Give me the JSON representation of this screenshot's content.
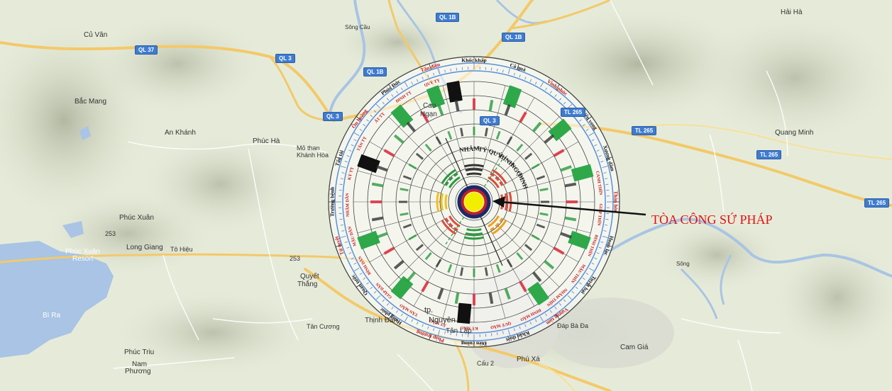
{
  "map": {
    "callout_text": "TÒA CÔNG SỨ PHÁP",
    "place_labels": [
      "Hải Hà",
      "Củ Vân",
      "Bắc Mang",
      "An Khánh",
      "Phúc Hà",
      "Mỏ than",
      "Khánh Hòa",
      "Phúc Xuân",
      "Phúc Xuân",
      "Resort",
      "Long Giang",
      "Quyết",
      "Thắng",
      "Bì Ra",
      "Phúc Triu",
      "Nam",
      "Phương",
      "Thịnh Đán",
      "Tân Cương",
      "Tân Lập",
      "Phú Xá",
      "Cam Giá",
      "Đáp Bà Đa",
      "Quang Minh",
      "Sông Cầu",
      "Cao",
      "Ngạn",
      "tp.",
      "Nguyên",
      "Sông"
    ],
    "road_labels": [
      "QL 37",
      "QL 3",
      "QL 1B",
      "QL 1B",
      "QL 3",
      "QL 1B",
      "QL 3",
      "TL 265",
      "TL 265",
      "TL 265",
      "TL 265",
      "253",
      "253",
      "Tô Hiệu",
      "Cấu 2"
    ],
    "compass": {
      "outer_ring_labels": [
        "Tấn điền",
        "Khốc khấp",
        "Cô quả",
        "Vinh phúc",
        "Thiếu vong",
        "Xương dâm",
        "Thân hôn",
        "Hoan lạc",
        "Tuyệt bại",
        "Vượng tàm",
        "Khẩu thiệt",
        "Điên cuồng",
        "Pháp trường",
        "Hưng phúc",
        "Quan tước",
        "Tử tuyệt",
        "Trường bệnh",
        "Tấn tài",
        "Ôn hoàng",
        "Phúc Đức"
      ],
      "inner_labels": [
        "NHÂM",
        "TÝ",
        "QUÝ",
        "BÍNH",
        "NGỌ",
        "ĐINH",
        "CANH THÌN",
        "GIÁP THÌN",
        "BÍNH THÌN",
        "MẬU THÌN",
        "NHÂM THÌN",
        "ĐINH MÃO",
        "QUÝ MÃO",
        "KỶ MÃO",
        "ẤT MÃO",
        "TÂN MÃO",
        "GIÁP DẦN",
        "BÍNH DẦN",
        "MẬU DẦN",
        "NHÂM DẦN",
        "KỶ TỴ",
        "TÂN TỴ",
        "ẤT TỴ",
        "ĐINH TỴ",
        "QUÝ TỴ"
      ]
    }
  }
}
